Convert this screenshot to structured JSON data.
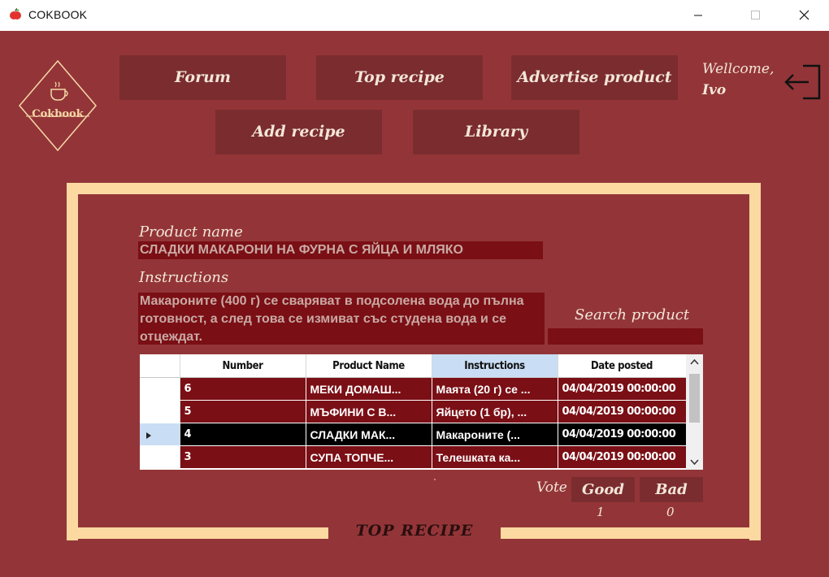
{
  "window": {
    "title": "COKBOOK",
    "controls": {
      "minimize": "minimize-icon",
      "maximize": "maximize-icon",
      "close": "close-icon"
    }
  },
  "logo": {
    "text": "Cokbook",
    "icon": "coffee-cup-icon"
  },
  "nav": {
    "forum": "Forum",
    "top_recipe": "Top recipe",
    "advertise_product": "Advertise product",
    "add_recipe": "Add recipe",
    "library": "Library"
  },
  "user": {
    "greeting": "Wellcome,",
    "name": "Ivo",
    "logout_icon": "logout-icon"
  },
  "detail": {
    "product_name_label": "Product name",
    "product_name_value": "СЛАДКИ МАКАРОНИ НА ФУРНА С ЯЙЦА И МЛЯКО",
    "instructions_label": "Instructions",
    "instructions_value": "Макароните (400 г) се сваряват в подсолена вода до пълна готовност, а след това се измиват със студена вода и се отцеждат."
  },
  "search": {
    "label": "Search product",
    "value": ""
  },
  "grid": {
    "columns": [
      "Number",
      "Product Name",
      "Instructions",
      "Date posted"
    ],
    "selected_column": "Instructions",
    "rows": [
      {
        "number": "6",
        "product": "МЕКИ ДОМАШ...",
        "instructions": "Маята (20 г) се ...",
        "date": "04/04/2019 00:00:00",
        "selected": false
      },
      {
        "number": "5",
        "product": "МЪФИНИ С В...",
        "instructions": "Яйцето (1 бр), ...",
        "date": "04/04/2019 00:00:00",
        "selected": false
      },
      {
        "number": "4",
        "product": "СЛАДКИ МАК...",
        "instructions": "Макароните (...",
        "date": "04/04/2019 00:00:00",
        "selected": true
      },
      {
        "number": "3",
        "product": "СУПА ТОПЧЕ...",
        "instructions": "Телешката ка...",
        "date": "04/04/2019 00:00:00",
        "selected": false
      }
    ]
  },
  "vote": {
    "label": "Vote",
    "good_label": "Good",
    "bad_label": "Bad",
    "good_count": "1",
    "bad_count": "0"
  },
  "footer": {
    "top_recipe_label": "TOP RECIPE"
  },
  "colors": {
    "background": "#933538",
    "button": "#7b2c2f",
    "frame": "#fcd9a0",
    "cell": "#7a0f15",
    "selection": "#c9def5"
  }
}
